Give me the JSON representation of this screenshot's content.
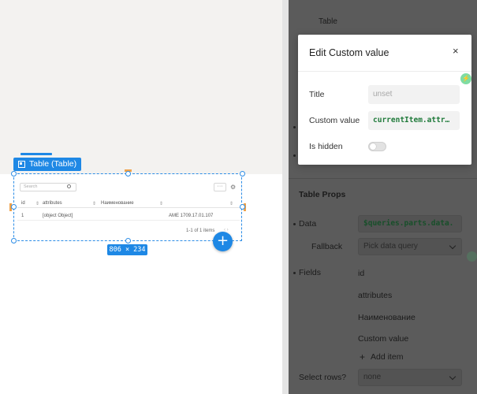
{
  "canvas": {
    "selected_label": "Table (Table)",
    "dimensions": "806 × 234",
    "fab_label": "+",
    "table": {
      "search_placeholder": "Search",
      "more_label": "···",
      "columns": [
        "id",
        "attributes",
        "Наименование"
      ],
      "row": {
        "id": "1",
        "attributes": "[object Object]",
        "name": "AME 1709.17.01.107"
      },
      "footer": "1-1 of 1 items"
    }
  },
  "panel": {
    "top_label": "Table",
    "section_title": "Table Props",
    "data_label": "Data",
    "data_value": "$queries.parts.data.",
    "fallback_label": "Fallback",
    "fallback_placeholder": "Pick data query",
    "fields_label": "Fields",
    "fields": [
      "id",
      "attributes",
      "Наименование",
      "Custom value"
    ],
    "add_item": "Add item",
    "select_rows_label": "Select rows?",
    "select_rows_value": "none"
  },
  "modal": {
    "title": "Edit Custom value",
    "close_label": "×",
    "title_label": "Title",
    "title_placeholder": "unset",
    "custom_value_label": "Custom value",
    "custom_value": "currentItem.attr…",
    "is_hidden_label": "Is hidden",
    "is_hidden": false
  },
  "colors": {
    "accent": "#1e88e5",
    "code_green": "#1f7a3a",
    "overlay": "#5b5b5b"
  }
}
